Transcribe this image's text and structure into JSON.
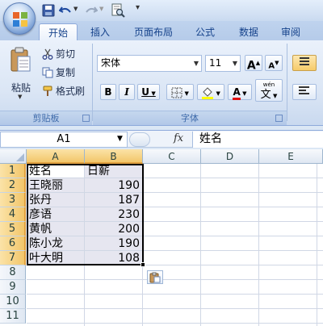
{
  "quick_access": {
    "icons": [
      "save-icon",
      "undo-icon",
      "redo-icon",
      "print-preview-icon",
      "customize-icon"
    ]
  },
  "tabs": [
    {
      "label": "开始",
      "active": true
    },
    {
      "label": "插入",
      "active": false
    },
    {
      "label": "页面布局",
      "active": false
    },
    {
      "label": "公式",
      "active": false
    },
    {
      "label": "数据",
      "active": false
    },
    {
      "label": "审阅",
      "active": false
    }
  ],
  "ribbon": {
    "clipboard": {
      "paste_label": "粘贴",
      "cut_label": "剪切",
      "copy_label": "复制",
      "format_painter_label": "格式刷",
      "group_label": "剪贴板"
    },
    "font": {
      "font_name": "宋体",
      "font_size": "11",
      "bold_label": "B",
      "italic_label": "I",
      "underline_label": "U",
      "grow_label": "A",
      "shrink_label": "A",
      "font_color_label": "A",
      "phonetic_label": "wén",
      "phonetic_char": "文",
      "group_label": "字体"
    }
  },
  "formula_bar": {
    "name_box": "A1",
    "fx_label": "fx",
    "content": "姓名"
  },
  "grid": {
    "columns": [
      "A",
      "B",
      "C",
      "D",
      "E"
    ],
    "selected_columns": [
      "A",
      "B"
    ],
    "rows": [
      "1",
      "2",
      "3",
      "4",
      "5",
      "6",
      "7",
      "8",
      "9",
      "10",
      "11"
    ],
    "selected_rows": [
      "1",
      "2",
      "3",
      "4",
      "5",
      "6",
      "7"
    ],
    "cells": [
      [
        "姓名",
        "日薪"
      ],
      [
        "王晓丽",
        "190"
      ],
      [
        "张丹",
        "187"
      ],
      [
        "彦语",
        "230"
      ],
      [
        "黄帆",
        "200"
      ],
      [
        "陈小龙",
        "190"
      ],
      [
        "叶大明",
        "108"
      ]
    ]
  },
  "colors": {
    "accent": "#15428b",
    "selection_header": "#f2c66a",
    "selected_cells": "#e6e6f0",
    "grid_line": "#d0d7e5"
  }
}
